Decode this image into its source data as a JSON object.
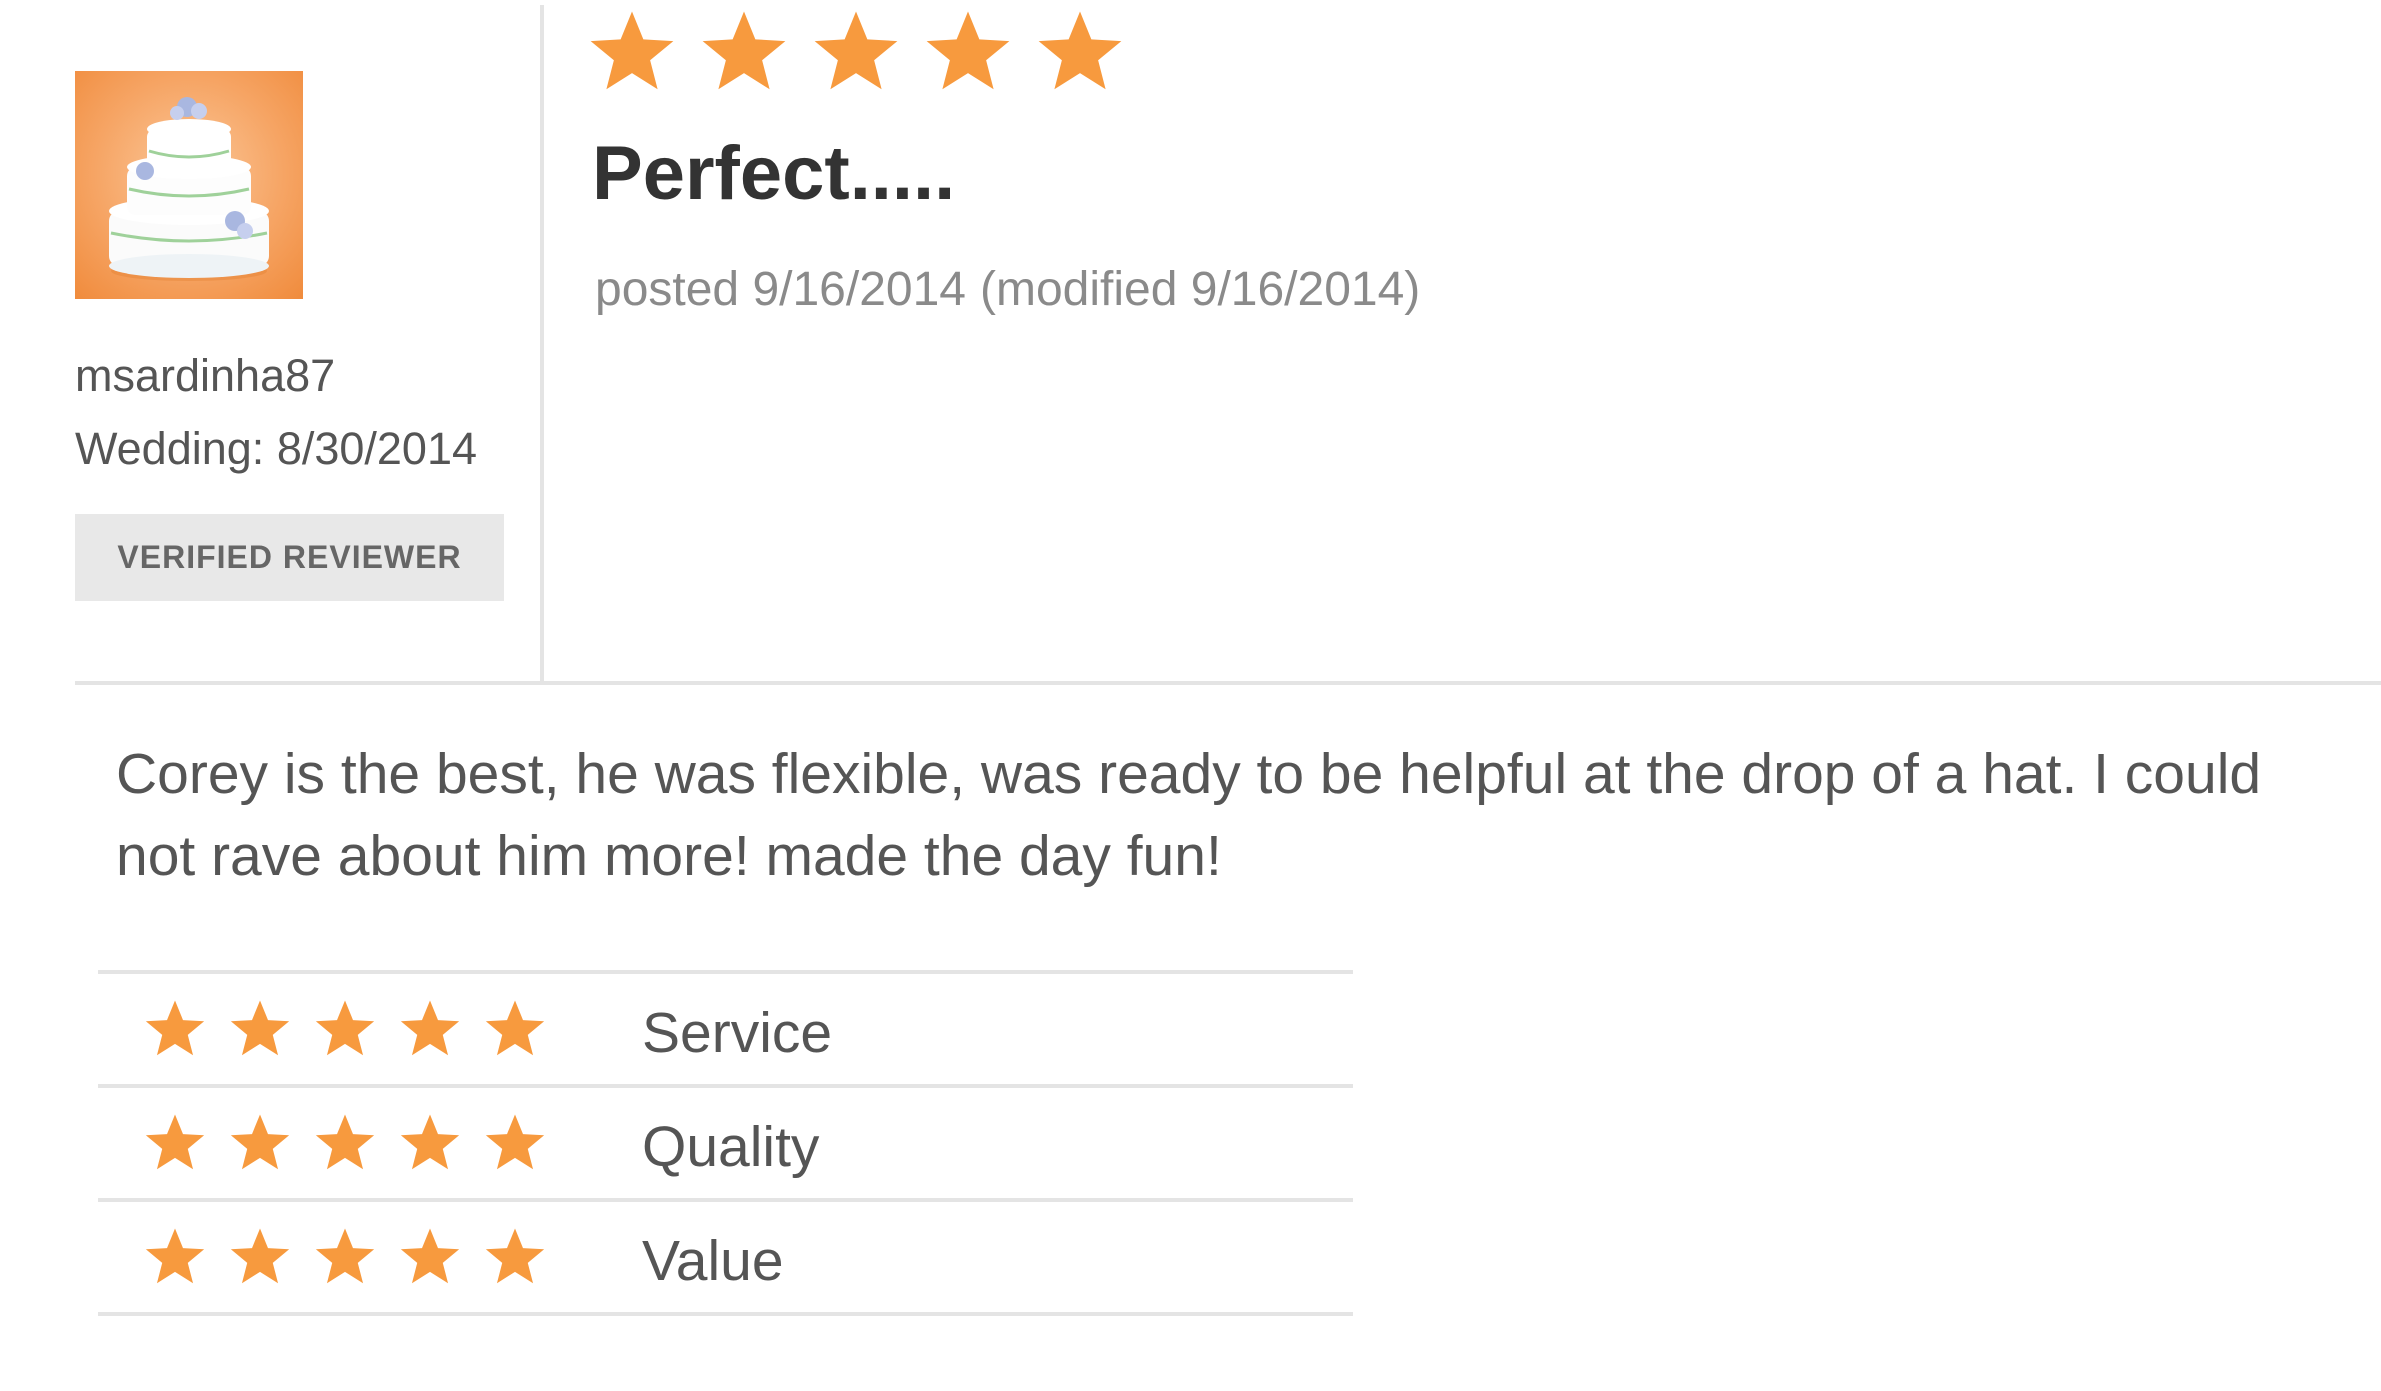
{
  "reviewer": {
    "avatar_icon": "wedding-cake-icon",
    "username": "msardinha87",
    "wedding_label": "Wedding:",
    "wedding_date": "8/30/2014",
    "badge": "VERIFIED REVIEWER"
  },
  "review": {
    "overall_rating": 5,
    "max_rating": 5,
    "title": "Perfect.....",
    "posted_label": "posted 9/16/2014",
    "modified_label": "(modified 9/16/2014)",
    "body": "Corey is the best, he was flexible, was ready to be helpful at the drop of a hat. I could not rave about him more! made the day fun!"
  },
  "ratings": [
    {
      "label": "Service",
      "stars": 5
    },
    {
      "label": "Quality",
      "stars": 5
    },
    {
      "label": "Value",
      "stars": 5
    }
  ],
  "colors": {
    "star": "#f79a3e",
    "text": "#555555",
    "title": "#333333",
    "muted": "#8a8a8a",
    "badge_bg": "#e8e8e8",
    "divider": "#e4e4e4"
  }
}
